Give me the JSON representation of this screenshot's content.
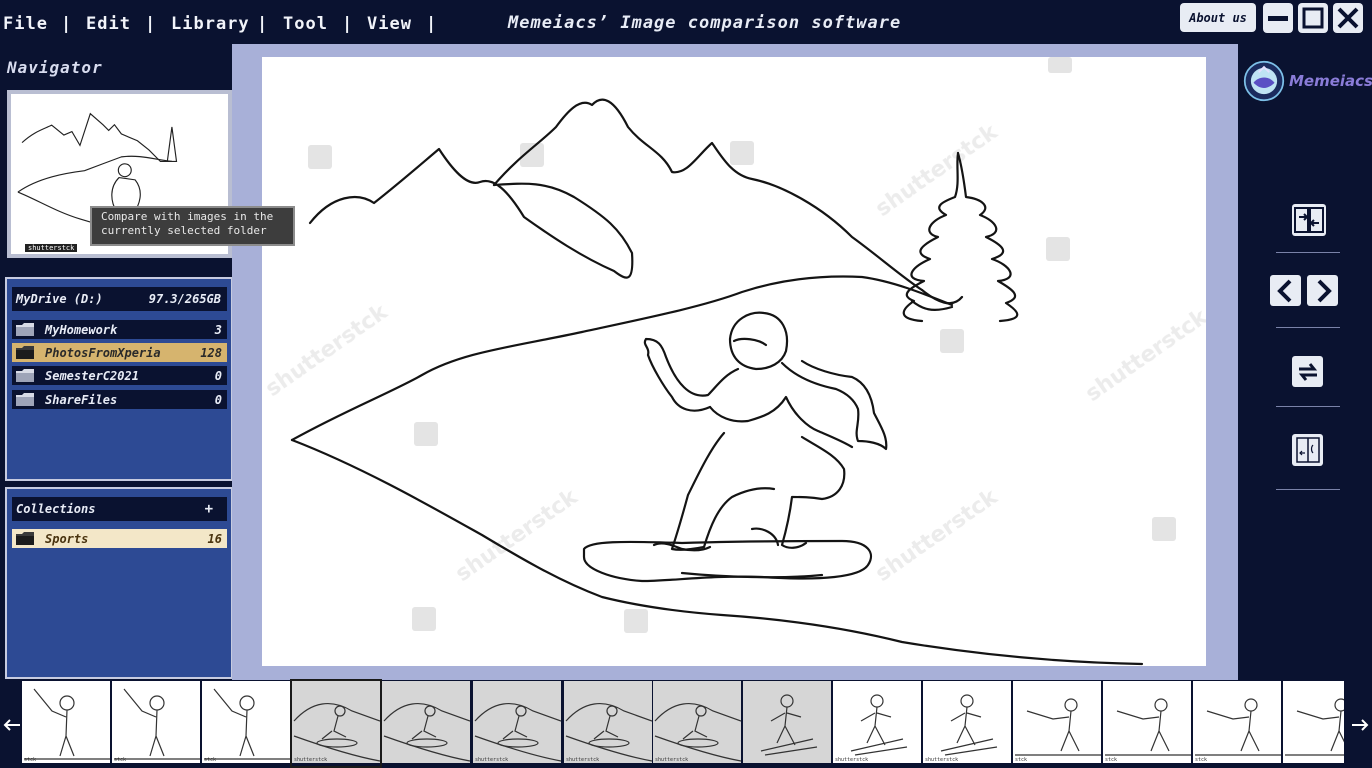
{
  "menu": {
    "items": [
      "File",
      "Edit",
      "Library",
      "Tool",
      "View"
    ],
    "separator": "|"
  },
  "app_title": "Memeiacs’ Image comparison software",
  "window": {
    "about_label": "About us",
    "minimize_icon": "minimize-icon",
    "maximize_icon": "maximize-icon",
    "close_icon": "close-icon"
  },
  "navigator": {
    "title": "Navigator",
    "tooltip_line1": "Compare with images in the",
    "tooltip_line2": "currently selected folder",
    "thumb_caption": "shutterstck"
  },
  "drive": {
    "name": "MyDrive (D:)",
    "usage": "97.3/265GB",
    "folders": [
      {
        "name": "MyHomework",
        "count": "3"
      },
      {
        "name": "PhotosFromXperia",
        "count": "128"
      },
      {
        "name": "SemesterC2021",
        "count": "0"
      },
      {
        "name": "ShareFiles",
        "count": "0"
      }
    ],
    "selected_index": 1
  },
  "collections": {
    "title": "Collections",
    "add_label": "+",
    "items": [
      {
        "name": "Sports",
        "count": "16"
      }
    ]
  },
  "logo": {
    "text": "Memeiacs"
  },
  "tools": [
    "compare-icon",
    "prev-icon",
    "next-icon",
    "swap-icon",
    "split-view-icon"
  ],
  "filmstrip": {
    "left_arrow": "←",
    "right_arrow": "→",
    "thumbnails": [
      {
        "subject": "golf",
        "caption": "stck",
        "gray": false
      },
      {
        "subject": "golf",
        "caption": "stck",
        "gray": false
      },
      {
        "subject": "golf",
        "caption": "stck",
        "gray": false
      },
      {
        "subject": "snowboard",
        "caption": "shutterstck",
        "gray": true,
        "current": true
      },
      {
        "subject": "snowboard",
        "caption": "",
        "gray": true
      },
      {
        "subject": "snowboard",
        "caption": "shutterstck",
        "gray": true
      },
      {
        "subject": "snowboard",
        "caption": "shutterstck",
        "gray": true
      },
      {
        "subject": "snowboard",
        "caption": "shutterstck",
        "gray": true
      },
      {
        "subject": "ski",
        "caption": "",
        "gray": true
      },
      {
        "subject": "ski",
        "caption": "shutterstck",
        "gray": false
      },
      {
        "subject": "ski",
        "caption": "shutterstck",
        "gray": false
      },
      {
        "subject": "fencing",
        "caption": "stck",
        "gray": false
      },
      {
        "subject": "fencing",
        "caption": "stck",
        "gray": false
      },
      {
        "subject": "fencing",
        "caption": "stck",
        "gray": false
      },
      {
        "subject": "fencing",
        "caption": "",
        "gray": false
      }
    ]
  },
  "watermark": "shutterstck",
  "colors": {
    "background": "#0a1230",
    "panel_blue": "#2d4a94",
    "viewer_frame": "#a8b0d8",
    "selected_folder": "#d6b46e",
    "collection_item": "#f3e7c8"
  }
}
